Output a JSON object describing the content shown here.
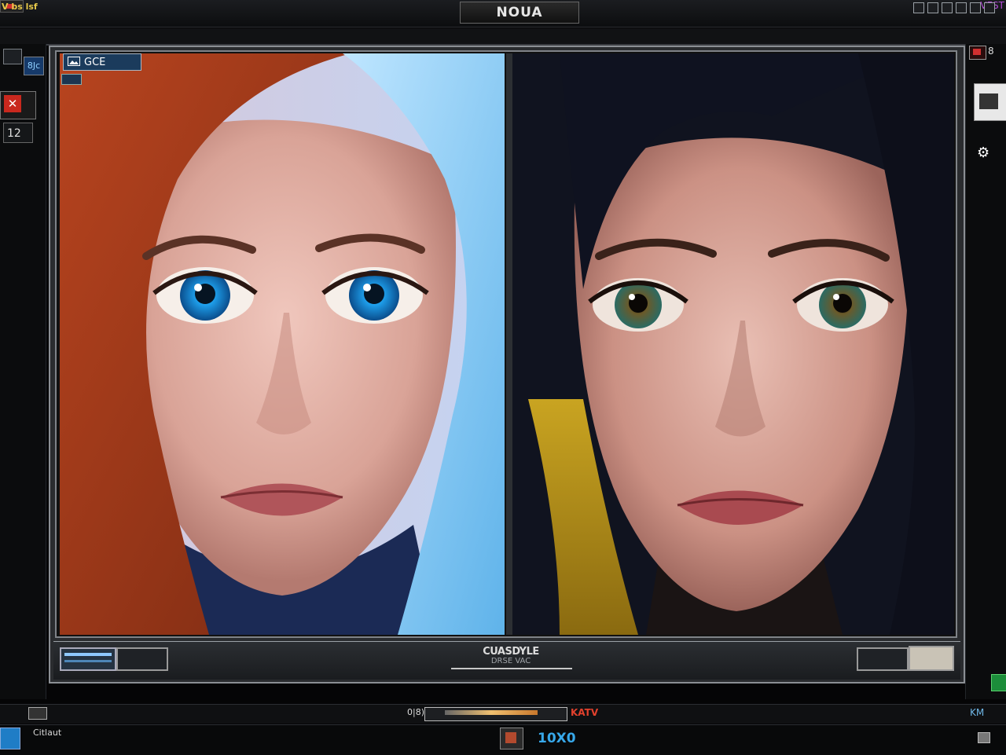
{
  "window": {
    "title": "NOUA",
    "title_right": "VEST"
  },
  "toolbar": {
    "left_label": "V bs lsf"
  },
  "left_panel": {
    "badge": "8Jc",
    "number": "12"
  },
  "right_panel": {
    "label": "8"
  },
  "viewer": {
    "badge_label": "GCE"
  },
  "control_strip": {
    "title": "CUASDYLE",
    "subtitle": "DRSE VAC"
  },
  "status": {
    "center_label": "0|8)",
    "red_label": "KATV",
    "right_label": "KM",
    "left_label": "Citlaut",
    "number": "10X0"
  },
  "colors": {
    "accent_blue": "#37a8ea",
    "accent_red": "#c9281e",
    "background": "#050506"
  },
  "icons": {
    "left_red": "close-icon",
    "right_scan": "scanner-icon",
    "viewer_badge": "image-icon",
    "status_left": "window-icon"
  }
}
